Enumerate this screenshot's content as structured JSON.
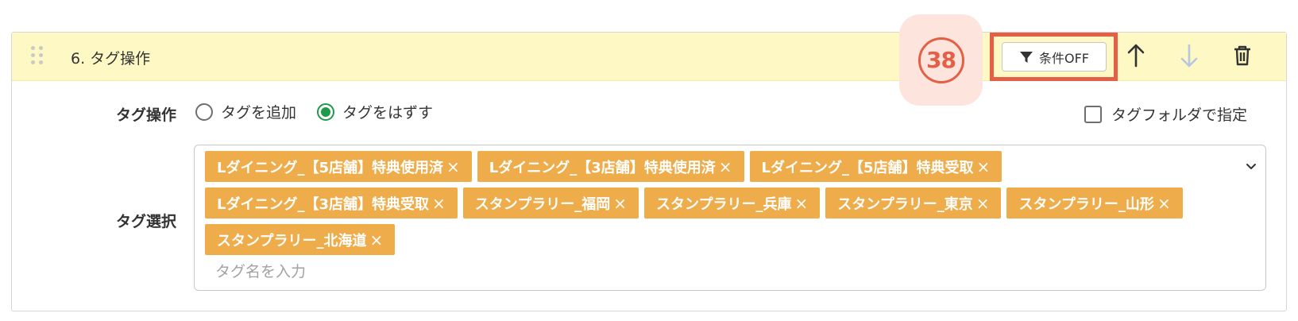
{
  "step": {
    "number": "38",
    "title": "6. タグ操作"
  },
  "header": {
    "condition_label": "条件OFF"
  },
  "operation": {
    "label": "タグ操作",
    "options": [
      {
        "label": "タグを追加",
        "checked": false
      },
      {
        "label": "タグをはずす",
        "checked": true
      }
    ],
    "folder_label": "タグフォルダで指定"
  },
  "selection": {
    "label": "タグ選択",
    "tags": [
      "Lダイニング_【5店舗】特典使用済",
      "Lダイニング_【3店舗】特典使用済",
      "Lダイニング_【5店舗】特典受取",
      "Lダイニング_【3店舗】特典受取",
      "スタンプラリー_福岡",
      "スタンプラリー_兵庫",
      "スタンプラリー_東京",
      "スタンプラリー_山形",
      "スタンプラリー_北海道"
    ],
    "remove_symbol": "×",
    "input_placeholder": "タグ名を入力"
  },
  "colors": {
    "header_bg": "#fdf8c4",
    "tag_bg": "#eeac4a",
    "accent": "#e45f45",
    "radio_checked": "#1f9a4a"
  },
  "icons": [
    "drag-handle-icon",
    "filter-icon",
    "arrow-up-icon",
    "arrow-down-icon",
    "trash-icon",
    "chevron-down-icon"
  ]
}
